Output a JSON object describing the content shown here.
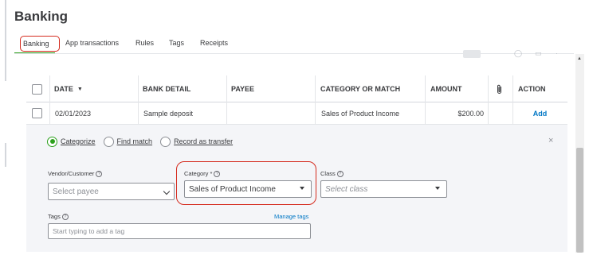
{
  "page": {
    "title": "Banking"
  },
  "tabs": [
    {
      "label": "Banking",
      "active": true
    },
    {
      "label": "App transactions"
    },
    {
      "label": "Rules"
    },
    {
      "label": "Tags"
    },
    {
      "label": "Receipts"
    }
  ],
  "table": {
    "headers": {
      "date": "DATE",
      "bank_detail": "BANK DETAIL",
      "payee": "PAYEE",
      "category": "CATEGORY OR MATCH",
      "amount": "AMOUNT",
      "attachment_icon": "paperclip-icon",
      "action": "ACTION"
    },
    "sort_indicator": "▼",
    "rows": [
      {
        "date": "02/01/2023",
        "bank_detail": "Sample deposit",
        "payee": "",
        "category": "Sales of Product Income",
        "amount": "$200.00",
        "action": "Add"
      }
    ]
  },
  "panel": {
    "radios": [
      {
        "label": "Categorize",
        "selected": true
      },
      {
        "label": "Find match",
        "selected": false
      },
      {
        "label": "Record as transfer",
        "selected": false
      }
    ],
    "close": "×",
    "vendor": {
      "label": "Vendor/Customer",
      "placeholder": "Select payee"
    },
    "category": {
      "label": "Category *",
      "value": "Sales of Product Income"
    },
    "class": {
      "label": "Class",
      "placeholder": "Select class"
    },
    "tags": {
      "label": "Tags",
      "placeholder": "Start typing to add a tag",
      "manage_link": "Manage tags"
    }
  },
  "colors": {
    "accent_green": "#2ca01c",
    "highlight_red": "#d52b1e",
    "link_blue": "#0077c5"
  }
}
